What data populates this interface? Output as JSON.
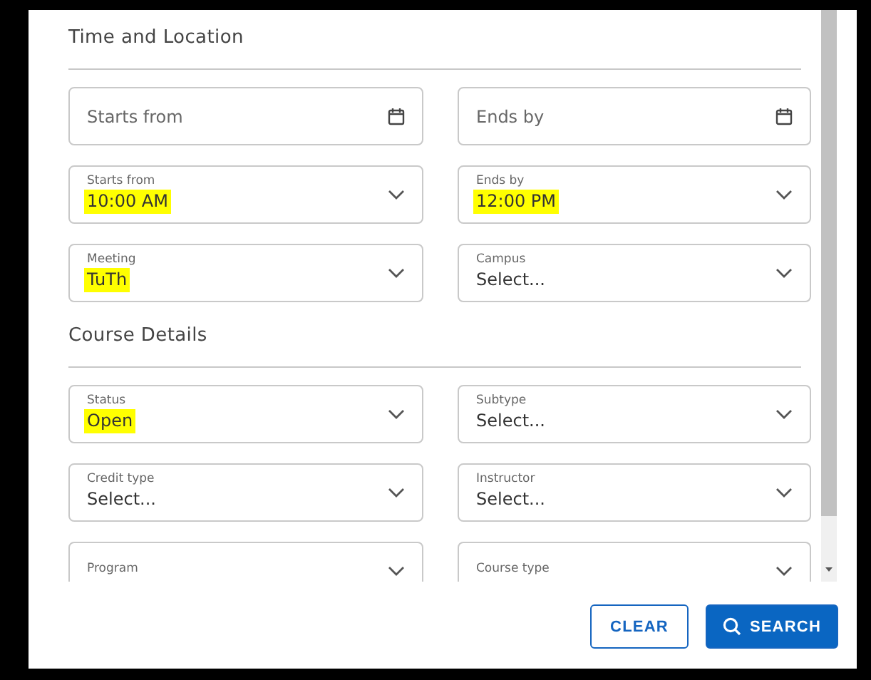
{
  "sections": [
    {
      "title": "Time and Location",
      "fields": [
        {
          "kind": "date",
          "placeholder": "Starts from"
        },
        {
          "kind": "date",
          "placeholder": "Ends by"
        },
        {
          "kind": "select",
          "label": "Starts from",
          "value": "10:00 AM",
          "highlighted": true
        },
        {
          "kind": "select",
          "label": "Ends by",
          "value": "12:00 PM",
          "highlighted": true
        },
        {
          "kind": "select",
          "label": "Meeting",
          "value": "TuTh",
          "highlighted": true
        },
        {
          "kind": "select",
          "label": "Campus",
          "value": "Select...",
          "highlighted": false
        }
      ]
    },
    {
      "title": "Course Details",
      "fields": [
        {
          "kind": "select",
          "label": "Status",
          "value": "Open",
          "highlighted": true
        },
        {
          "kind": "select",
          "label": "Subtype",
          "value": "Select...",
          "highlighted": false
        },
        {
          "kind": "select",
          "label": "Credit type",
          "value": "Select...",
          "highlighted": false
        },
        {
          "kind": "select",
          "label": "Instructor",
          "value": "Select...",
          "highlighted": false
        },
        {
          "kind": "select",
          "label": "Program"
        },
        {
          "kind": "select",
          "label": "Course type"
        }
      ]
    }
  ],
  "buttons": [
    {
      "kind": "outline",
      "label": "CLEAR"
    },
    {
      "kind": "primary",
      "label": "SEARCH"
    }
  ]
}
